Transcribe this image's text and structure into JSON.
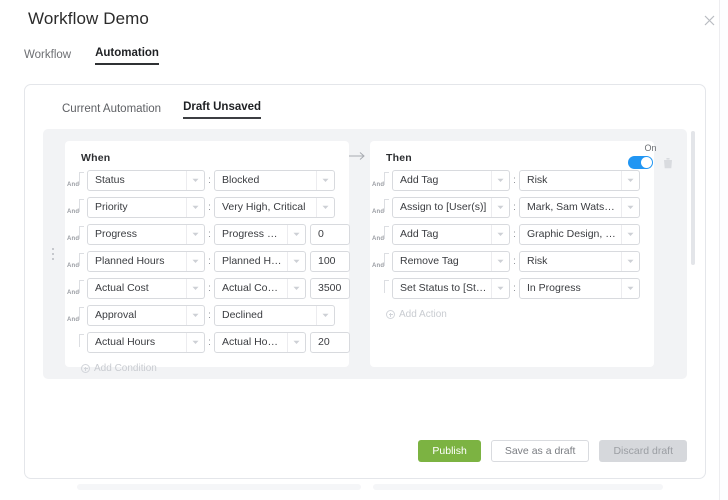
{
  "header": {
    "title": "Workflow Demo",
    "close_icon": "close-icon"
  },
  "tabs_top": [
    {
      "label": "Workflow",
      "active": false
    },
    {
      "label": "Automation",
      "active": true
    }
  ],
  "tabs_sub": [
    {
      "label": "Current Automation",
      "active": false
    },
    {
      "label": "Draft Unsaved",
      "active": true
    }
  ],
  "rule": {
    "connector_icon": "arrow-right-icon",
    "drag_handle_icon": "drag-handle-icon",
    "toggle": {
      "label": "On",
      "state": "on",
      "color": "#2196f3"
    },
    "delete_icon": "trash-icon",
    "when": {
      "title": "When",
      "conjunction": "And",
      "add_label": "Add Condition",
      "rows": [
        {
          "field": "Status",
          "operator": "Blocked",
          "value": ""
        },
        {
          "field": "Priority",
          "operator": "Very High, Critical",
          "value": ""
        },
        {
          "field": "Progress",
          "operator": "Progress = X%",
          "value": "0"
        },
        {
          "field": "Planned Hours",
          "operator": "Planned Hou...",
          "value": "100"
        },
        {
          "field": "Actual Cost",
          "operator": "Actual Cost ...",
          "value": "3500"
        },
        {
          "field": "Approval",
          "operator": "Declined",
          "value": ""
        },
        {
          "field": "Actual Hours",
          "operator": "Actual Hours...",
          "value": "20"
        }
      ]
    },
    "then": {
      "title": "Then",
      "conjunction": "And",
      "add_label": "Add Action",
      "rows": [
        {
          "field": "Add Tag",
          "operator": "Risk",
          "value": ""
        },
        {
          "field": "Assign to [User(s)]",
          "operator": "Mark, Sam Watson ...",
          "value": ""
        },
        {
          "field": "Add Tag",
          "operator": "Graphic Design, Issue",
          "value": ""
        },
        {
          "field": "Remove Tag",
          "operator": "Risk",
          "value": ""
        },
        {
          "field": "Set Status to [Status]",
          "operator": "In Progress",
          "value": ""
        }
      ]
    }
  },
  "footer": {
    "publish_label": "Publish",
    "save_label": "Save as a draft",
    "discard_label": "Discard draft",
    "publish_color": "#7cb342"
  }
}
